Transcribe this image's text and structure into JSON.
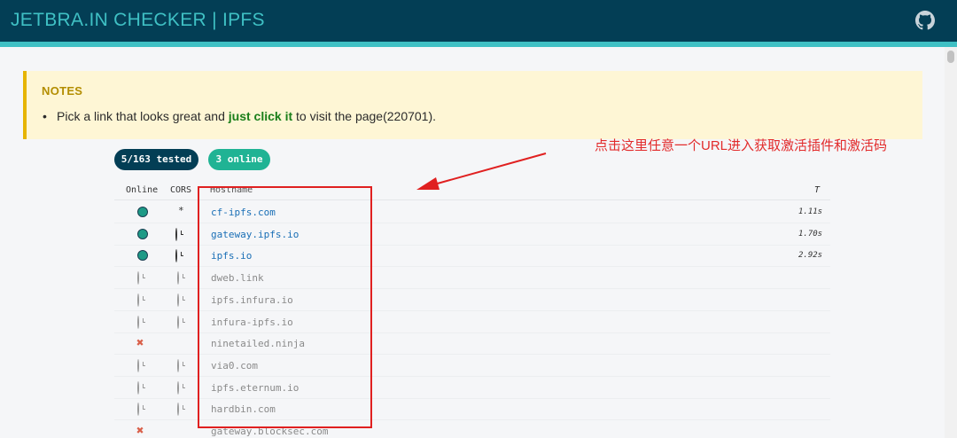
{
  "header": {
    "title": "JETBRA.IN CHECKER | IPFS",
    "github_icon": "github-icon"
  },
  "colors": {
    "header_bg": "#033e55",
    "accent": "#3fc0c4",
    "online": "#1d9a86",
    "annotation": "#e22b2b"
  },
  "notes": {
    "title": "NOTES",
    "text_before": "Pick a link that looks great and ",
    "link_text": "just click it",
    "text_after": " to visit the page(220701)."
  },
  "badges": {
    "tested": "5/163 tested",
    "online": "3 online"
  },
  "annotation": "点击这里任意一个URL进入获取激活插件和激活码",
  "table": {
    "headers": {
      "online": "Online",
      "cors": "CORS",
      "hostname": "Hostname",
      "time": "T"
    },
    "rows": [
      {
        "online": "online",
        "cors": "*",
        "hostname": "cf-ipfs.com",
        "time": "1.11s"
      },
      {
        "online": "online",
        "cors": "clock",
        "hostname": "gateway.ipfs.io",
        "time": "1.70s"
      },
      {
        "online": "online",
        "cors": "clock",
        "hostname": "ipfs.io",
        "time": "2.92s"
      },
      {
        "online": "pending",
        "cors": "clock",
        "hostname": "dweb.link",
        "time": ""
      },
      {
        "online": "pending",
        "cors": "clock",
        "hostname": "ipfs.infura.io",
        "time": ""
      },
      {
        "online": "pending",
        "cors": "clock",
        "hostname": "infura-ipfs.io",
        "time": ""
      },
      {
        "online": "failed",
        "cors": "",
        "hostname": "ninetailed.ninja",
        "time": ""
      },
      {
        "online": "pending",
        "cors": "clock",
        "hostname": "via0.com",
        "time": ""
      },
      {
        "online": "pending",
        "cors": "clock",
        "hostname": "ipfs.eternum.io",
        "time": ""
      },
      {
        "online": "pending",
        "cors": "clock",
        "hostname": "hardbin.com",
        "time": ""
      },
      {
        "online": "failed",
        "cors": "",
        "hostname": "gateway.blocksec.com",
        "time": ""
      }
    ]
  }
}
